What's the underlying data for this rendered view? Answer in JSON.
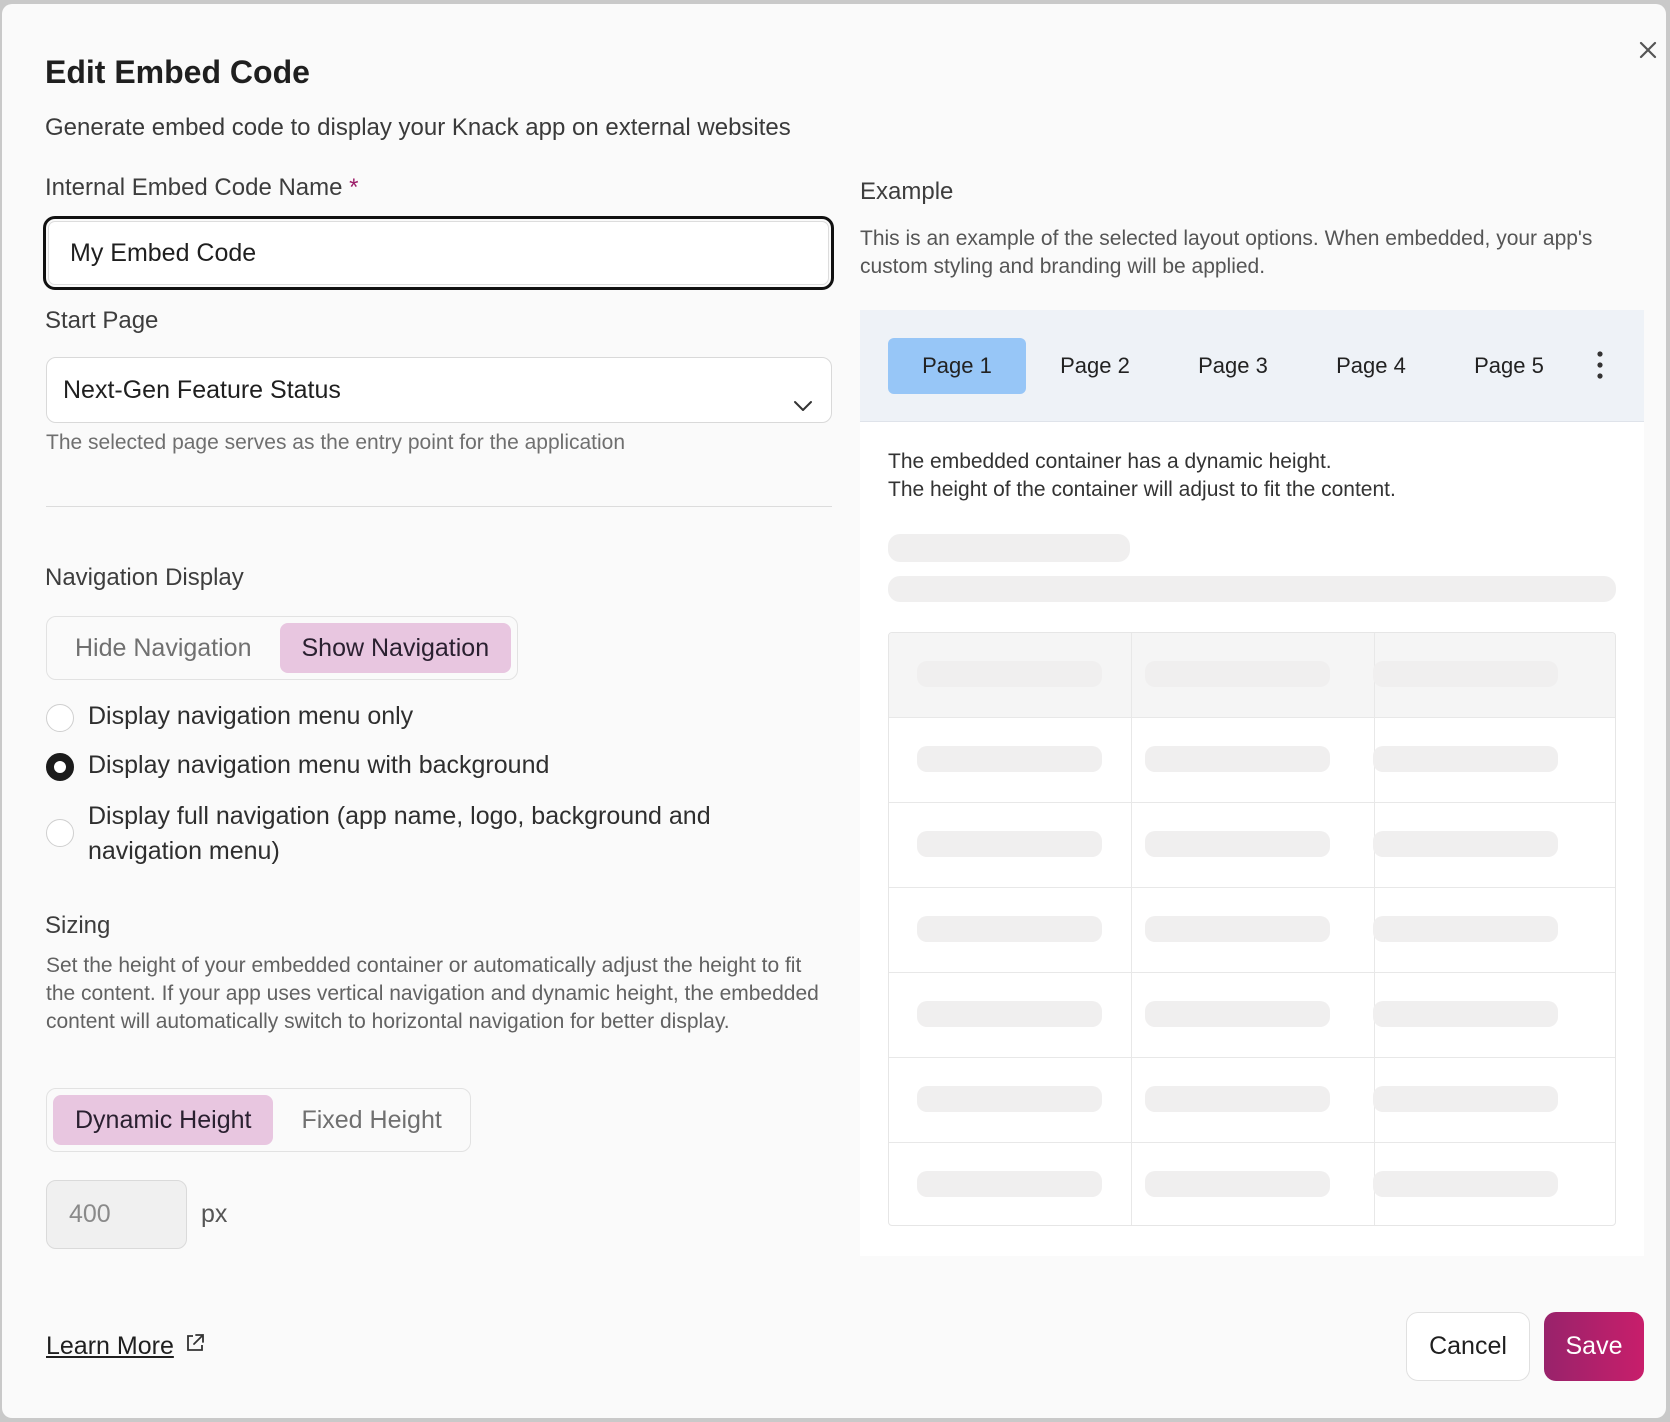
{
  "dialog": {
    "title": "Edit Embed Code",
    "subtitle": "Generate embed code to display your Knack app on external websites"
  },
  "form": {
    "name_label": "Internal Embed Code Name",
    "required_mark": "*",
    "name_value": "My Embed Code",
    "start_page_label": "Start Page",
    "start_page_value": "Next-Gen Feature Status",
    "start_page_hint": "The selected page serves as the entry point for the application",
    "nav_display_label": "Navigation Display",
    "nav_toggle": [
      "Hide Navigation",
      "Show Navigation"
    ],
    "nav_toggle_selected": "Show Navigation",
    "nav_options": [
      "Display navigation menu only",
      "Display navigation menu with background",
      "Display full navigation (app name, logo, background and navigation menu)"
    ],
    "nav_option_selected": "Display navigation menu with background",
    "sizing_label": "Sizing",
    "sizing_desc": "Set the height of your embedded container or automatically adjust the height to fit the content. If your app uses vertical navigation and dynamic height, the embedded content will automatically switch to horizontal navigation for better display.",
    "height_toggle": [
      "Dynamic Height",
      "Fixed Height"
    ],
    "height_toggle_selected": "Dynamic Height",
    "height_value": "400",
    "height_unit": "px"
  },
  "example": {
    "label": "Example",
    "desc": "This is an example of the selected layout options. When embedded, your app's custom styling and branding will be applied.",
    "tabs": [
      "Page 1",
      "Page 2",
      "Page 3",
      "Page 4",
      "Page 5"
    ],
    "active_tab": "Page 1",
    "text_line1": "The embedded container has a dynamic height.",
    "text_line2": "The height of the container will adjust to fit the content."
  },
  "footer": {
    "learn_more": "Learn More",
    "cancel": "Cancel",
    "save": "Save"
  },
  "colors": {
    "accent": "#c81e6b",
    "toggle_active": "#e8c6e0",
    "tab_active": "#97c6f7"
  }
}
